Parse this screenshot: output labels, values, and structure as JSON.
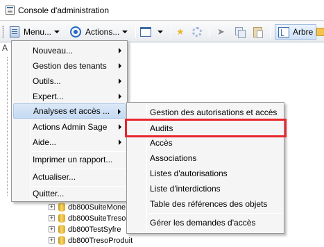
{
  "window": {
    "title": "Console d'administration"
  },
  "toolbar": {
    "menu_label": "Menu...",
    "actions_label": "Actions...",
    "arbre_label": "Arbre"
  },
  "tree_header": "A",
  "context_menu": {
    "items": [
      {
        "label": "Nouveau...",
        "submenu": true
      },
      {
        "label": "Gestion des tenants",
        "submenu": true
      },
      {
        "label": "Outils...",
        "submenu": true
      },
      {
        "label": "Expert...",
        "submenu": true
      },
      {
        "label": "Analyses et accès ...",
        "submenu": true
      },
      {
        "label": "Actions Admin Sage",
        "submenu": true
      },
      {
        "label": "Aide...",
        "submenu": true
      },
      {
        "label": "Imprimer un rapport...",
        "submenu": false
      },
      {
        "label": "Actualiser...",
        "submenu": false
      },
      {
        "label": "Quitter...",
        "submenu": false
      }
    ]
  },
  "submenu": {
    "items": [
      "Gestion des autorisations et accès",
      "Audits",
      "Accès",
      "Associations",
      "Listes d'autorisations",
      "Liste d'interdictions",
      "Table des références des objets",
      "Gérer les demandes d'accès"
    ]
  },
  "tree_items": [
    {
      "label": "db800SuiteMone"
    },
    {
      "label": "db800SuiteTreso"
    },
    {
      "label": "db800TestSyfre"
    },
    {
      "label": "db800TresoProduit"
    }
  ],
  "colors": {
    "highlight_box": "#e8262d",
    "menu_highlight": "#c5daf2"
  }
}
